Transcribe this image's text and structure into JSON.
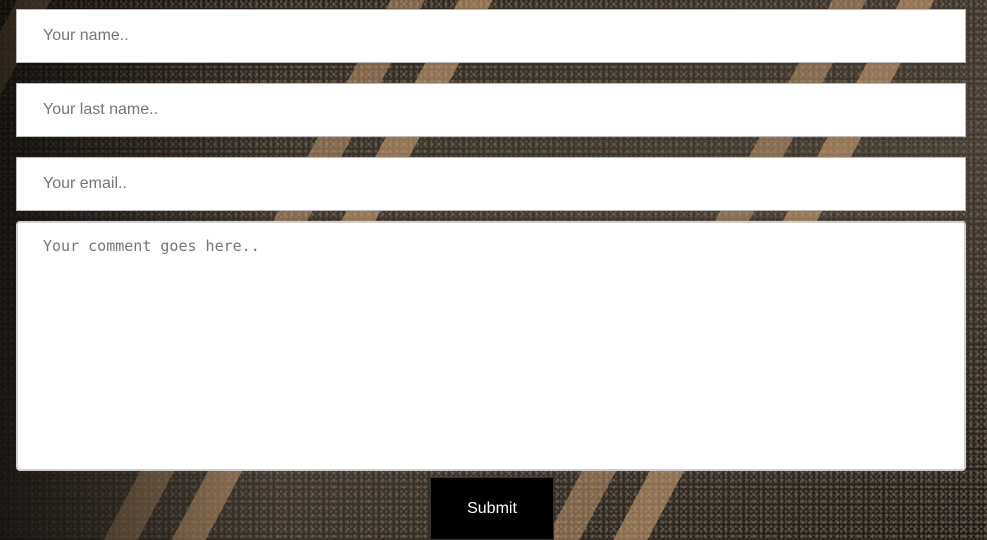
{
  "form": {
    "first_name_placeholder": "Your name..",
    "last_name_placeholder": "Your last name..",
    "email_placeholder": "Your email..",
    "comment_placeholder": "Your comment goes here..",
    "submit_label": "Submit"
  },
  "colors": {
    "field_background": "#ffffff",
    "placeholder_text": "#757575",
    "button_background": "#000000",
    "button_text": "#ffffff"
  }
}
